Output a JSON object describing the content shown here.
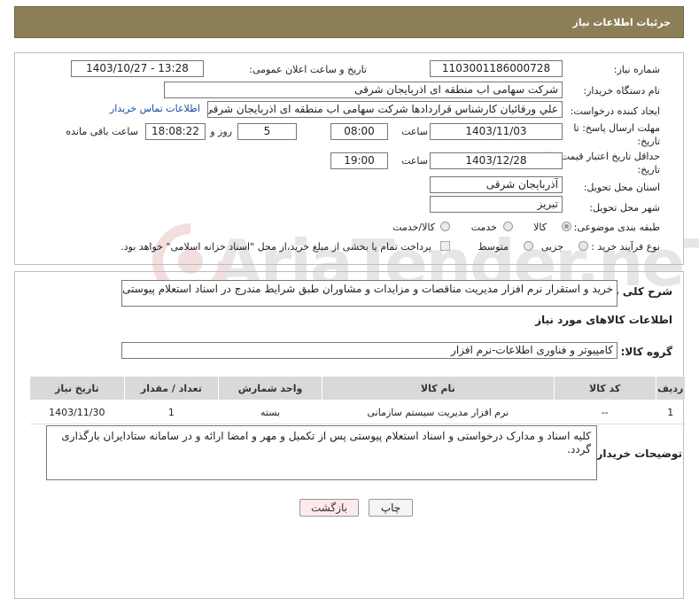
{
  "header": {
    "title": "جزئیات اطلاعات نیاز"
  },
  "form": {
    "need_number_label": "شماره نیاز:",
    "need_number": "1103001186000728",
    "announce_label": "تاریخ و ساعت اعلان عمومی:",
    "announce_value": "1403/10/27 - 13:28",
    "buyer_org_label": "نام دستگاه خریدار:",
    "buyer_org": "شرکت سهامی اب منطقه ای اذربایجان شرقی",
    "creator_label": "ایجاد کننده درخواست:",
    "creator": "علي ورقائيان کارشناس قراردادها شرکت سهامی اب منطقه ای اذربایجان شرقی",
    "contact_link": "اطلاعات تماس خریدار",
    "deadline_label_1": "مهلت ارسال پاسخ: تا",
    "deadline_label_2": "تاریخ:",
    "deadline_date": "1403/11/03",
    "time_label": "ساعت",
    "deadline_time": "08:00",
    "days_value": "5",
    "days_label": "روز و",
    "remaining_time": "18:08:22",
    "remaining_label": "ساعت باقی مانده",
    "validity_label_1": "حداقل تاریخ اعتبار قیمت: تا",
    "validity_label_2": "تاریخ:",
    "validity_date": "1403/12/28",
    "validity_time_label": "ساعت",
    "validity_time": "19:00",
    "province_label": "استان محل تحویل:",
    "province": "آذربایجان شرقی",
    "city_label": "شهر محل تحویل:",
    "city": "تبریز",
    "category_label": "طبقه بندی موضوعی:",
    "category_options": [
      "کالا",
      "خدمت",
      "کالا/خدمت"
    ],
    "process_label": "نوع فرآیند خرید :",
    "process_options": [
      "جزیی",
      "متوسط"
    ],
    "payment_note": "پرداخت تمام یا بخشی از مبلغ خرید،از محل \"اسناد خزانه اسلامی\" خواهد بود."
  },
  "description": {
    "label": "شرح کلی نیاز:",
    "text": "خرید و استقرار نرم افزار مدیریت مناقصات و مزایدات و مشاوران طبق شرایط مندرج در اسناد استعلام پیوستی"
  },
  "goods": {
    "section_title": "اطلاعات کالاهای مورد نیاز",
    "group_label": "گروه کالا:",
    "group_value": "کامپیوتر و فناوری اطلاعات-نرم افزار",
    "columns": [
      "ردیف",
      "کد کالا",
      "نام کالا",
      "واحد شمارش",
      "تعداد / مقدار",
      "تاریخ نیاز"
    ],
    "rows": [
      {
        "row": "1",
        "code": "--",
        "name": "نرم افزار مدیریت سیستم سازمانی",
        "unit": "بسته",
        "qty": "1",
        "date": "1403/11/30"
      }
    ]
  },
  "buyer_notes": {
    "label": "توضیحات خریدار:",
    "text": "کلیه اسناد و مدارک درخواستی و اسناد استعلام پیوستی پس از تکمیل و مهر و امضا ارائه و در سامانه ستادایران بارگذاری گردد."
  },
  "buttons": {
    "print": "چاپ",
    "back": "بازگشت"
  },
  "watermark": {
    "text": "AriaTender.neT"
  }
}
